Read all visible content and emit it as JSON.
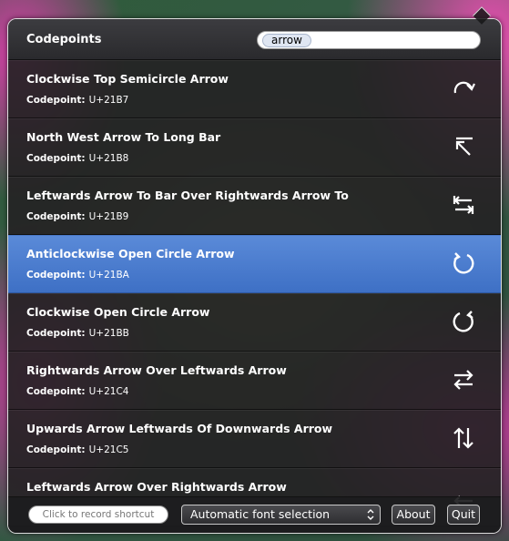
{
  "header": {
    "title": "Codepoints",
    "search_value": "arrow"
  },
  "rows": [
    {
      "name": "Clockwise Top Semicircle Arrow",
      "label": "Codepoint:",
      "code": "U+21B7",
      "icon": "clockwise-top-semicircle-arrow-icon",
      "selected": false
    },
    {
      "name": "North West Arrow To Long Bar",
      "label": "Codepoint:",
      "code": "U+21B8",
      "icon": "north-west-arrow-to-long-bar-icon",
      "selected": false
    },
    {
      "name": "Leftwards Arrow To Bar Over Rightwards Arrow To",
      "label": "Codepoint:",
      "code": "U+21B9",
      "icon": "leftwards-rightwards-arrows-to-bar-icon",
      "selected": false
    },
    {
      "name": "Anticlockwise Open Circle Arrow",
      "label": "Codepoint:",
      "code": "U+21BA",
      "icon": "anticlockwise-open-circle-arrow-icon",
      "selected": true
    },
    {
      "name": "Clockwise Open Circle Arrow",
      "label": "Codepoint:",
      "code": "U+21BB",
      "icon": "clockwise-open-circle-arrow-icon",
      "selected": false
    },
    {
      "name": "Rightwards Arrow Over Leftwards Arrow",
      "label": "Codepoint:",
      "code": "U+21C4",
      "icon": "rightwards-over-leftwards-arrow-icon",
      "selected": false
    },
    {
      "name": "Upwards Arrow Leftwards Of Downwards Arrow",
      "label": "Codepoint:",
      "code": "U+21C5",
      "icon": "upwards-leftwards-of-downwards-arrow-icon",
      "selected": false
    },
    {
      "name": "Leftwards Arrow Over Rightwards Arrow",
      "label": "",
      "code": "",
      "icon": "leftwards-over-rightwards-arrow-icon",
      "selected": false
    }
  ],
  "footer": {
    "shortcut_placeholder": "Click to record shortcut",
    "font_select": "Automatic font selection",
    "about_label": "About",
    "quit_label": "Quit"
  },
  "colors": {
    "selected_row": "#4a7bd0",
    "text": "#ffffff"
  }
}
